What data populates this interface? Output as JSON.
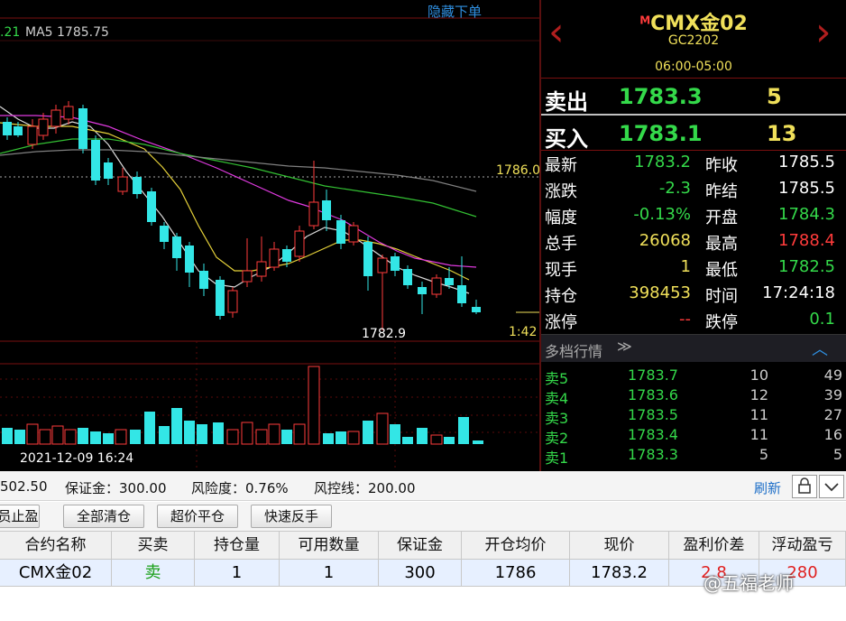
{
  "chart": {
    "ma_left_value": ".21",
    "ma5_label": "MA5 1785.75",
    "hide_link": "隐藏下单",
    "price_ref": "1786.0",
    "low_marker": "1782.9",
    "time_tag": "1:42",
    "datetime": "2021-12-09 16:24"
  },
  "quote": {
    "symbol_prefix": "M",
    "symbol": "CMX金02",
    "code": "GC2202",
    "session": "06:00-05:00",
    "ask": {
      "label": "卖出",
      "price": "1783.3",
      "volume": "5"
    },
    "bid": {
      "label": "买入",
      "price": "1783.1",
      "volume": "13"
    },
    "stats": [
      {
        "l1": "最新",
        "v1": "1783.2",
        "c1": "green",
        "l2": "昨收",
        "v2": "1785.5",
        "c2": "lab"
      },
      {
        "l1": "涨跌",
        "v1": "-2.3",
        "c1": "green",
        "l2": "昨结",
        "v2": "1785.5",
        "c2": "lab"
      },
      {
        "l1": "幅度",
        "v1": "-0.13%",
        "c1": "green",
        "l2": "开盘",
        "v2": "1784.3",
        "c2": "green"
      },
      {
        "l1": "总手",
        "v1": "26068",
        "c1": "yellow",
        "l2": "最高",
        "v2": "1788.4",
        "c2": "red"
      },
      {
        "l1": "现手",
        "v1": "1",
        "c1": "yellow",
        "l2": "最低",
        "v2": "1782.5",
        "c2": "green"
      },
      {
        "l1": "持仓",
        "v1": "398453",
        "c1": "yellow",
        "l2": "时间",
        "v2": "17:24:18",
        "c2": "lab"
      },
      {
        "l1": "涨停",
        "v1": "--",
        "c1": "red",
        "l2": "跌停",
        "v2": "0.1",
        "c2": "green"
      }
    ],
    "depth_title": "多档行情",
    "depth": [
      {
        "label": "卖5",
        "price": "1783.7",
        "vol": "10",
        "total": "49"
      },
      {
        "label": "卖4",
        "price": "1783.6",
        "vol": "12",
        "total": "39"
      },
      {
        "label": "卖3",
        "price": "1783.5",
        "vol": "11",
        "total": "27"
      },
      {
        "label": "卖2",
        "price": "1783.4",
        "vol": "11",
        "total": "16"
      },
      {
        "label": "卖1",
        "price": "1783.3",
        "vol": "5",
        "total": "5"
      }
    ]
  },
  "account": {
    "balance_partial": "502.50",
    "margin": "保证金：300.00",
    "risk": "风险度：0.76%",
    "risk_line": "风控线：200.00",
    "refresh": "刷新"
  },
  "actions": {
    "partial": "员止盈",
    "close_all": "全部清仓",
    "over_price": "超价平仓",
    "reverse": "快速反手"
  },
  "positions": {
    "headers": [
      "合约名称",
      "买卖",
      "持仓量",
      "可用数量",
      "保证金",
      "开仓均价",
      "现价",
      "盈利价差",
      "浮动盈亏"
    ],
    "row": [
      "CMX金02",
      "卖",
      "1",
      "1",
      "300",
      "1786",
      "1783.2",
      "2.8",
      "280"
    ]
  },
  "watermark": "@五福老师",
  "colors": {
    "up": "#ff3b3b",
    "down": "#33e6e6",
    "green": "#34d94a",
    "yellow": "#f0e05a",
    "bg": "#000000"
  }
}
